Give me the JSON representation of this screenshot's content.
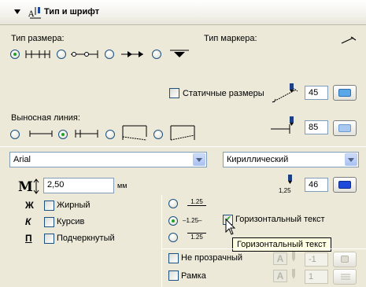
{
  "header": {
    "title": "Тип и шрифт"
  },
  "size_type": {
    "label": "Тип размера:"
  },
  "marker_type": {
    "label": "Тип маркера:"
  },
  "static_dims": {
    "label": "Статичные размеры",
    "pen_value": "45",
    "pen_color": "#5aa8e6"
  },
  "extension_line": {
    "label": "Выносная линия:",
    "pen_value": "85",
    "pen_color": "#a8c8f0"
  },
  "font": {
    "family": "Arial",
    "script": "Кириллический",
    "text_pen_label": "1,25",
    "text_pen_value": "46",
    "text_pen_color": "#1e4adc"
  },
  "text_size": {
    "value": "2,50",
    "unit": "мм"
  },
  "styles": {
    "bold_glyph": "Ж",
    "bold_label": "Жирный",
    "italic_glyph": "К",
    "italic_label": "Курсив",
    "underline_glyph": "П",
    "underline_label": "Подчеркнутый"
  },
  "placement": {
    "above": "1.25",
    "middle": "1.25",
    "below": "1.25"
  },
  "horizontal_text": {
    "label": "Горизонтальный текст",
    "tooltip": "Горизонтальный текст"
  },
  "opaque": {
    "label": "Не прозрачный",
    "pen_value": "-1"
  },
  "frame": {
    "label": "Рамка",
    "pen_value": "1"
  }
}
